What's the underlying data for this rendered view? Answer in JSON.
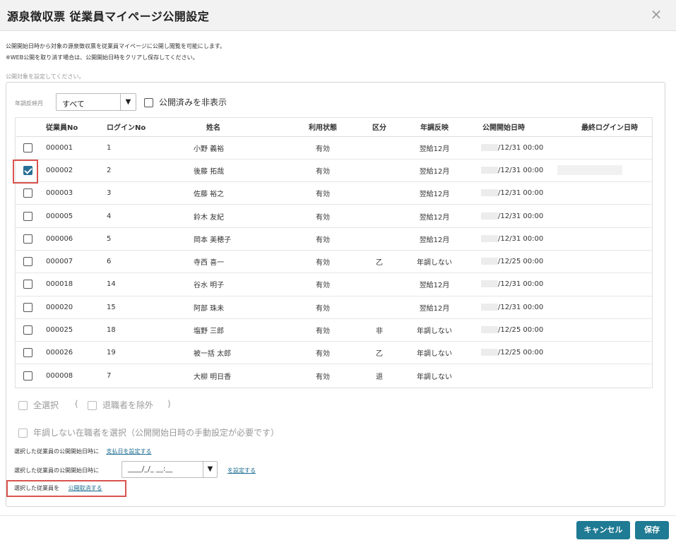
{
  "dialog": {
    "title": "源泉徴収票 従業員マイページ公開設定",
    "close_icon": "×",
    "desc_line1": "公開開始日時から対象の源泉徴収票を従業員マイページに公開し閲覧を可能にします。",
    "desc_line2": "※WEB公開を取り消す場合は、公開開始日時をクリアし保存してください。",
    "hint": "公開対象を設定してください。"
  },
  "filter": {
    "label": "年調反映月",
    "selected": "すべて",
    "arrow": "▼",
    "hide_published_label": "公開済みを非表示"
  },
  "table": {
    "headers": [
      "",
      "従業員No",
      "ログインNo",
      "姓名",
      "利用状態",
      "区分",
      "年調反映",
      "公開開始日時",
      "最終ログイン日時"
    ],
    "rows": [
      {
        "checked": false,
        "emp_no": "000001",
        "login_no": "1",
        "name": "小野 義裕",
        "status": "有効",
        "kubun": "",
        "nencho": "翌給12月",
        "start": "/12/31 00:00",
        "last_login": ""
      },
      {
        "checked": true,
        "emp_no": "000002",
        "login_no": "2",
        "name": "後藤 拓哉",
        "status": "有効",
        "kubun": "",
        "nencho": "翌給12月",
        "start": "/12/31 00:00",
        "last_login": ""
      },
      {
        "checked": false,
        "emp_no": "000003",
        "login_no": "3",
        "name": "佐藤 裕之",
        "status": "有効",
        "kubun": "",
        "nencho": "翌給12月",
        "start": "/12/31 00:00",
        "last_login": ""
      },
      {
        "checked": false,
        "emp_no": "000005",
        "login_no": "4",
        "name": "鈴木 友紀",
        "status": "有効",
        "kubun": "",
        "nencho": "翌給12月",
        "start": "/12/31 00:00",
        "last_login": ""
      },
      {
        "checked": false,
        "emp_no": "000006",
        "login_no": "5",
        "name": "岡本 美穂子",
        "status": "有効",
        "kubun": "",
        "nencho": "翌給12月",
        "start": "/12/31 00:00",
        "last_login": ""
      },
      {
        "checked": false,
        "emp_no": "000007",
        "login_no": "6",
        "name": "寺西 喜一",
        "status": "有効",
        "kubun": "乙",
        "nencho": "年調しない",
        "start": "/12/25 00:00",
        "last_login": ""
      },
      {
        "checked": false,
        "emp_no": "000018",
        "login_no": "14",
        "name": "谷水 明子",
        "status": "有効",
        "kubun": "",
        "nencho": "翌給12月",
        "start": "/12/31 00:00",
        "last_login": ""
      },
      {
        "checked": false,
        "emp_no": "000020",
        "login_no": "15",
        "name": "阿部 珠未",
        "status": "有効",
        "kubun": "",
        "nencho": "翌給12月",
        "start": "/12/31 00:00",
        "last_login": ""
      },
      {
        "checked": false,
        "emp_no": "000025",
        "login_no": "18",
        "name": "塩野 三郎",
        "status": "有効",
        "kubun": "非",
        "nencho": "年調しない",
        "start": "/12/25 00:00",
        "last_login": ""
      },
      {
        "checked": false,
        "emp_no": "000026",
        "login_no": "19",
        "name": "被一括 太郎",
        "status": "有効",
        "kubun": "乙",
        "nencho": "年調しない",
        "start": "/12/25 00:00",
        "last_login": ""
      },
      {
        "checked": false,
        "emp_no": "000008",
        "login_no": "7",
        "name": "大柳 明日香",
        "status": "有効",
        "kubun": "退",
        "nencho": "年調しない",
        "start": "",
        "last_login": ""
      }
    ]
  },
  "options": {
    "select_all": "全選択",
    "paren_open": "(",
    "exclude_retired": "退職者を除外",
    "paren_close": ")",
    "select_non_nencho": "年調しない在職者を選択（公開開始日時の手動設定が必要です）"
  },
  "actions": {
    "row1_prefix": "選択した従業員の公開開始日時に",
    "row1_link": "支払日を設定する",
    "row2_prefix": "選択した従業員の公開開始日時に",
    "row2_date_placeholder": "____/_/_ __:__",
    "row2_arrow": "▼",
    "row2_link": "を設定する",
    "row3_prefix": "選択した従業員を",
    "row3_link": "公開取消する"
  },
  "footer": {
    "cancel_label": "キャンセル",
    "save_label": "保存"
  },
  "colors": {
    "accent": "#1f7a93",
    "highlight": "#d9534f",
    "link": "#1a6b8f"
  }
}
